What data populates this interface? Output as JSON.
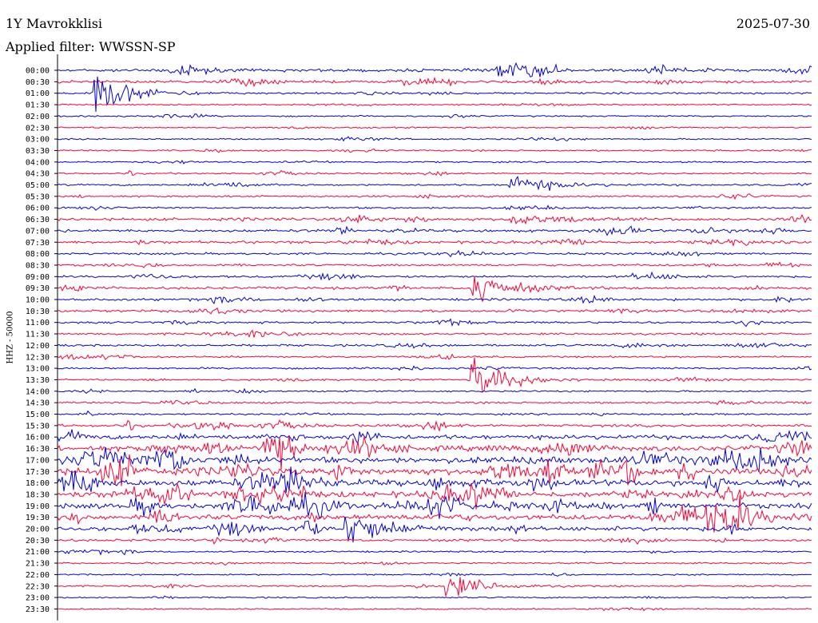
{
  "header": {
    "station": "1Y Mavrokklisi",
    "date": "2025-07-30",
    "filter": "Applied filter: WWSSN-SP"
  },
  "colors": {
    "trace_a": "#0000e0",
    "trace_b": "#ff0033",
    "axis": "#000000"
  },
  "chart_data": {
    "type": "line",
    "title": "1Y Mavrokklisi",
    "ylabel": "HHZ - 50000",
    "xlabel": "",
    "rows": [
      "00:00",
      "00:30",
      "01:00",
      "01:30",
      "02:00",
      "02:30",
      "03:00",
      "03:30",
      "04:00",
      "04:30",
      "05:00",
      "05:30",
      "06:00",
      "06:30",
      "07:00",
      "07:30",
      "08:00",
      "08:30",
      "09:00",
      "09:30",
      "10:00",
      "10:30",
      "11:00",
      "11:30",
      "12:00",
      "12:30",
      "13:00",
      "13:30",
      "14:00",
      "14:30",
      "15:00",
      "15:30",
      "16:00",
      "16:30",
      "17:00",
      "17:30",
      "18:00",
      "18:30",
      "19:00",
      "19:30",
      "20:00",
      "20:30",
      "21:00",
      "21:30",
      "22:00",
      "22:30",
      "23:00",
      "23:30"
    ],
    "row_minutes": 30,
    "series_colors_alternate": [
      "blue",
      "red"
    ],
    "relative_activity": [
      0.35,
      0.3,
      0.15,
      0.08,
      0.08,
      0.06,
      0.08,
      0.1,
      0.08,
      0.1,
      0.12,
      0.15,
      0.15,
      0.3,
      0.3,
      0.3,
      0.2,
      0.2,
      0.2,
      0.25,
      0.25,
      0.25,
      0.2,
      0.2,
      0.2,
      0.15,
      0.15,
      0.12,
      0.12,
      0.15,
      0.15,
      0.3,
      0.6,
      0.8,
      0.9,
      1.0,
      1.0,
      0.9,
      0.8,
      0.8,
      0.6,
      0.25,
      0.12,
      0.1,
      0.08,
      0.08,
      0.08,
      0.06
    ],
    "events": [
      {
        "time": "01:00",
        "minute": 1.5,
        "amplitude": 0.9
      },
      {
        "time": "05:00",
        "minute": 18,
        "amplitude": 0.5
      },
      {
        "time": "06:30",
        "minute": 18,
        "amplitude": 0.35
      },
      {
        "time": "09:30",
        "minute": 16.5,
        "amplitude": 0.7
      },
      {
        "time": "13:30",
        "minute": 16.5,
        "amplitude": 1.0
      },
      {
        "time": "20:00",
        "minute": 11.5,
        "amplitude": 0.85
      },
      {
        "time": "22:30",
        "minute": 15.5,
        "amplitude": 0.6
      }
    ],
    "grid": false
  }
}
